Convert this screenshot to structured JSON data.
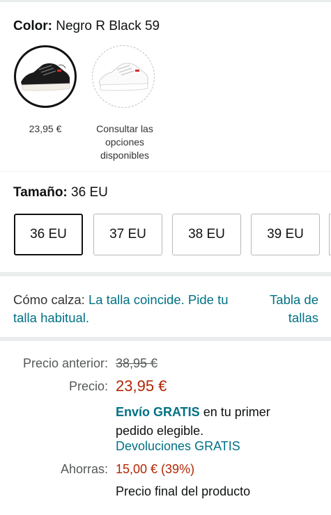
{
  "color": {
    "label": "Color:",
    "value": "Negro R Black 59",
    "options": [
      {
        "caption": "23,95 €",
        "selected": true
      },
      {
        "caption": "Consultar las opciones disponibles",
        "selected": false
      }
    ]
  },
  "size": {
    "label": "Tamaño:",
    "value": "36 EU",
    "options": [
      "36 EU",
      "37 EU",
      "38 EU",
      "39 EU"
    ]
  },
  "fit": {
    "label": "Cómo calza:",
    "text": "La talla coincide. Pide tu talla habitual.",
    "size_chart": "Tabla de tallas"
  },
  "price": {
    "previous_label": "Precio anterior:",
    "previous_value": "38,95 €",
    "price_label": "Precio:",
    "price_value": "23,95 €",
    "shipping_bold": "Envío GRATIS",
    "shipping_rest": "en tu primer pedido elegible.",
    "returns": "Devoluciones GRATIS",
    "savings_label": "Ahorras:",
    "savings_value": "15,00 € (39%)",
    "final_note": "Precio final del producto"
  }
}
